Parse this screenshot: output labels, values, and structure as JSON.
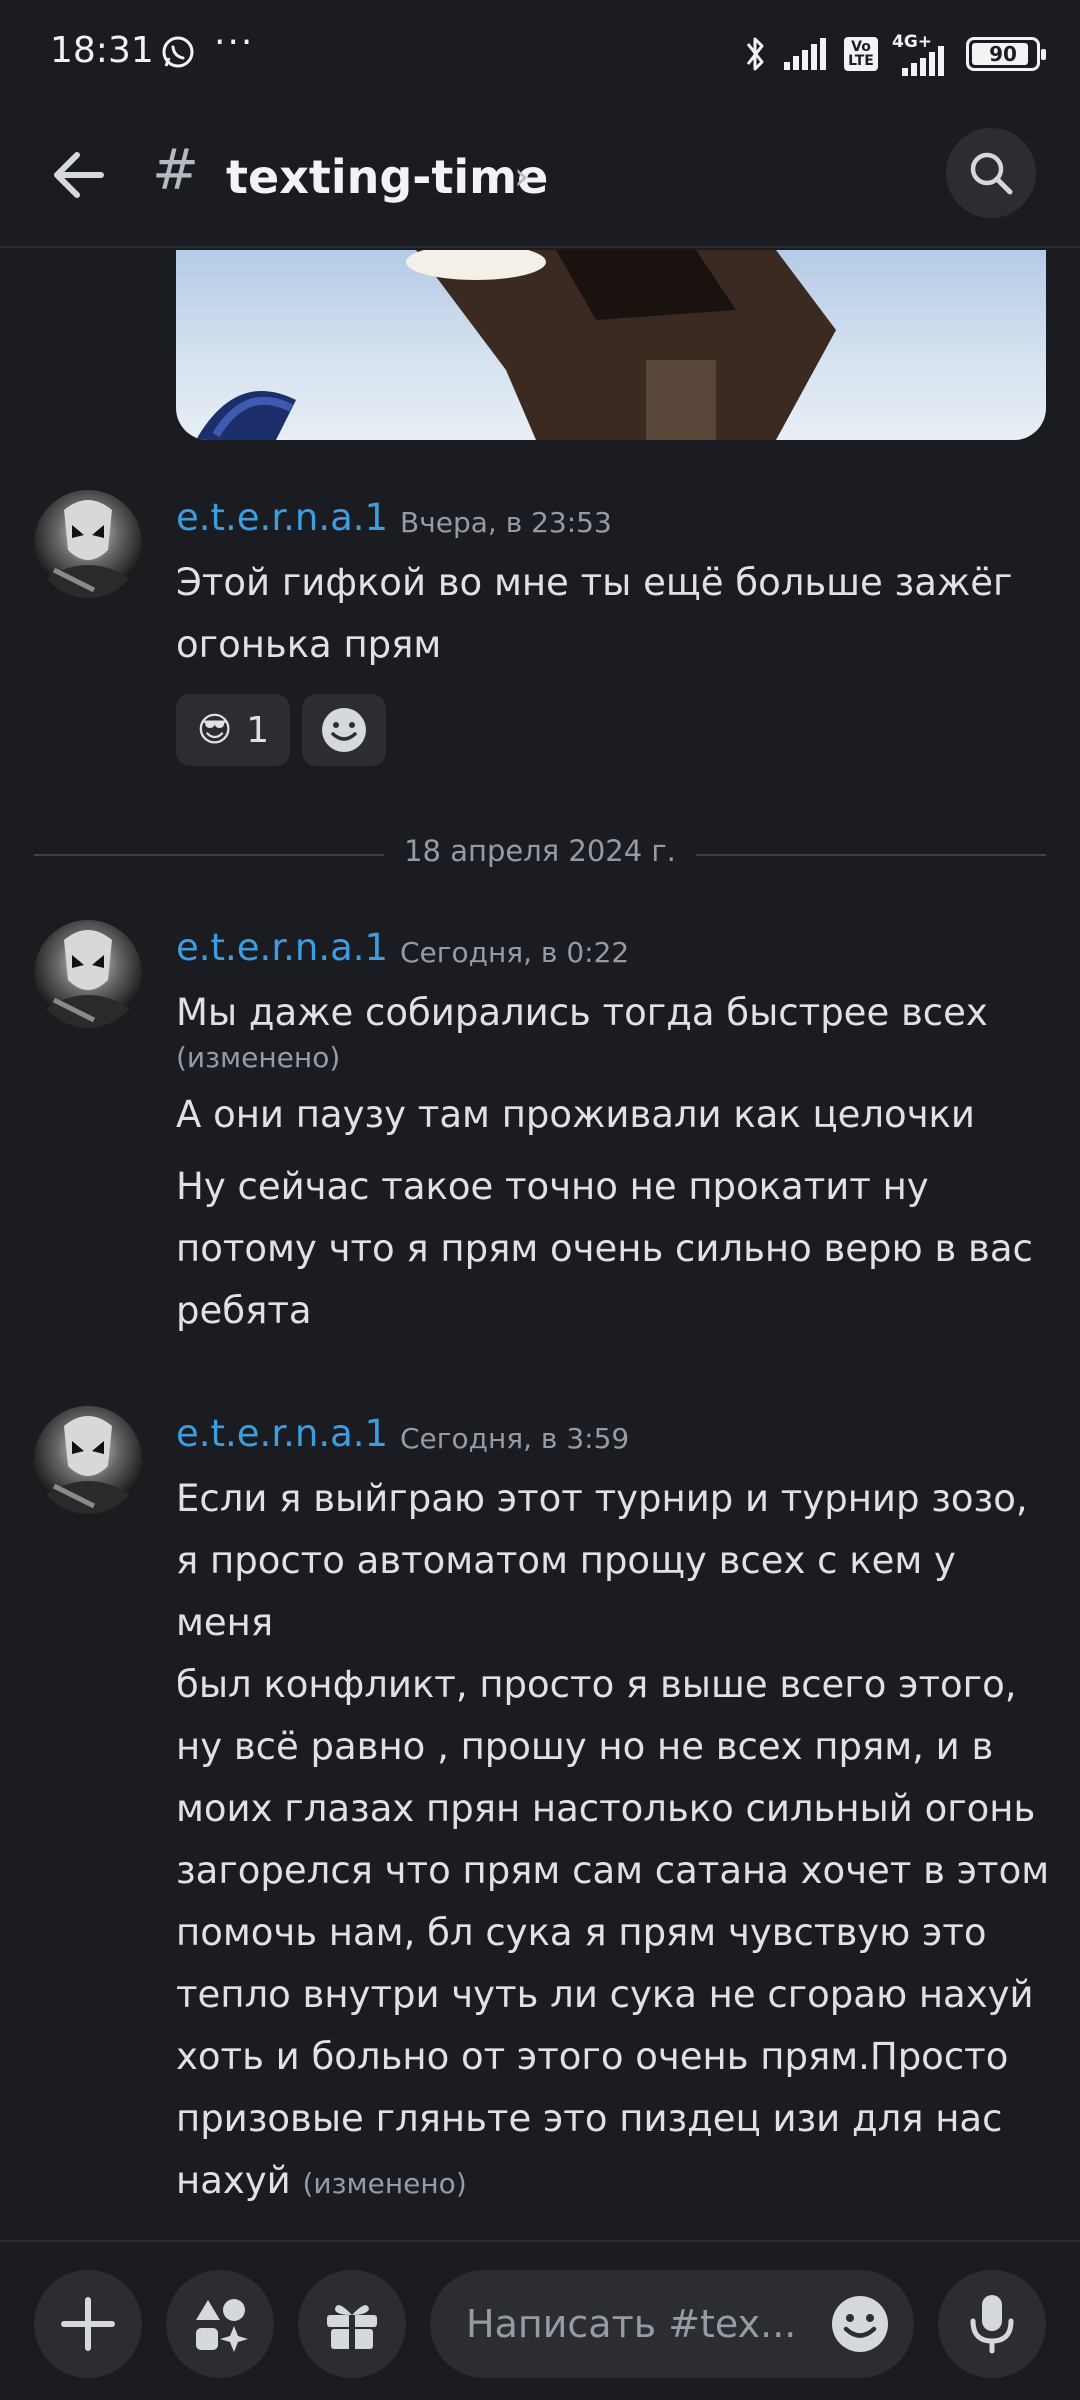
{
  "status_bar": {
    "time": "18:31",
    "dots": "···",
    "signal_tag_volte": "Vo LTE",
    "network": "4G+",
    "battery": "90",
    "battery_level": 0.9,
    "icons": [
      "whatsapp-icon",
      "bluetooth-icon",
      "signal-icon",
      "volte-icon",
      "signal-4g-icon",
      "battery-icon"
    ]
  },
  "header": {
    "back_icon": "arrow-left-icon",
    "channel_prefix": "#",
    "channel_name": "texting-time",
    "chevron": "›",
    "search_icon": "search-icon"
  },
  "messages": [
    {
      "author": "e.t.e.r.n.a.1",
      "timestamp": "Вчера, в 23:53",
      "lines": [
        "Этой гифкой во мне ты ещё больше зажёг",
        "огонька прям"
      ],
      "reactions": [
        {
          "emoji": "😎",
          "count": "1"
        },
        {
          "emoji": "add-reaction-icon",
          "count": ""
        }
      ]
    },
    {
      "author": "e.t.e.r.n.a.1",
      "timestamp": "Сегодня, в 0:22",
      "parts": [
        {
          "text": "Мы даже собирались  тогда быстрее всех",
          "edited": "(изменено)"
        },
        {
          "text": "А они паузу там проживали как целочки"
        },
        {
          "lines": [
            "Ну сейчас такое точно не прокатит ну",
            "потому что я прям очень сильно верю в вас",
            "ребята"
          ]
        }
      ]
    },
    {
      "author": "e.t.e.r.n.a.1",
      "timestamp": "Сегодня, в 3:59",
      "lines": [
        "Если я выйграю этот турнир и турнир зозо,",
        "я просто автоматом прощу всех с кем у меня",
        "был конфликт, просто я выше всего этого,",
        "ну всё равно ,  прошу но не всех прям, и в",
        "моих глазах прян настолько сильный огонь",
        "загорелся что прям сам сатана хочет  в этом",
        "помочь нам, бл сука я прям чувствую это",
        "тепло внутри чуть ли сука не сгораю нахуй",
        "хоть и больно от этого очень прям.Просто",
        "призовые гляньте это пиздец изи для нас",
        "нахуй"
      ],
      "edited": "(изменено)"
    }
  ],
  "date_divider": "18 апреля 2024 г.",
  "composer": {
    "placeholder": "Написать #tex...",
    "buttons": [
      "plus-icon",
      "apps-icon",
      "gift-icon",
      "emoji-icon",
      "microphone-icon"
    ]
  }
}
